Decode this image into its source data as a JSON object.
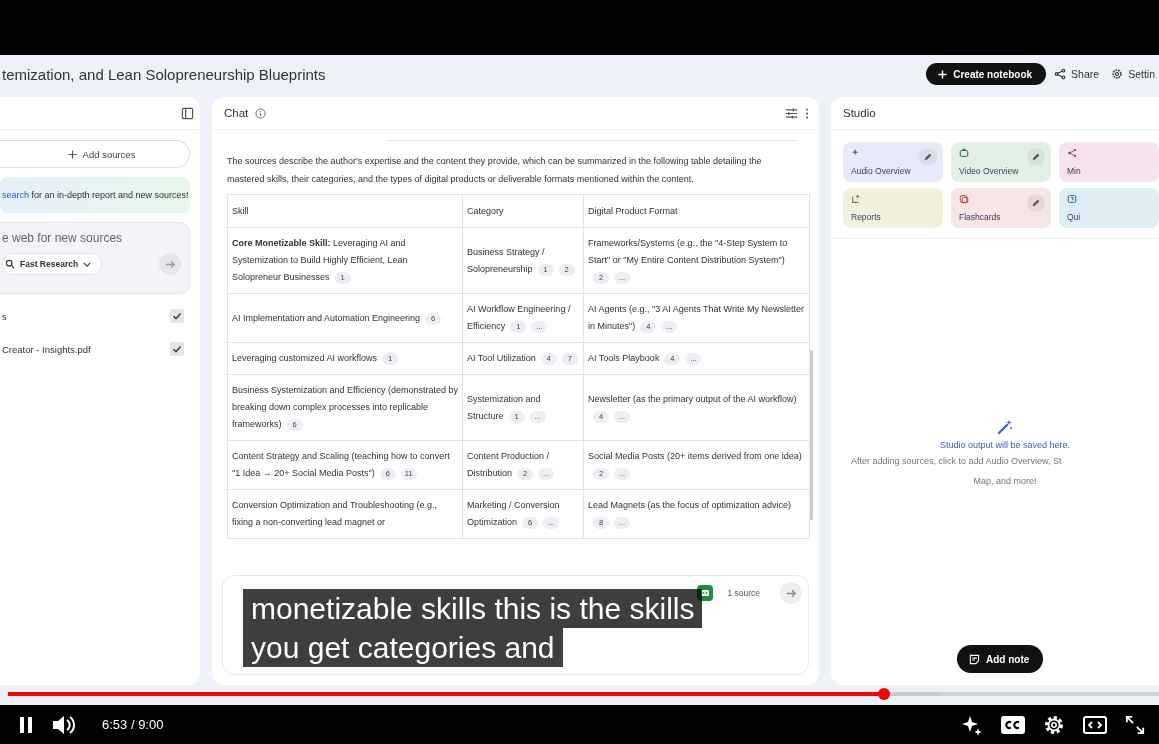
{
  "notebook_title": "temization, and Lean Solopreneurship Blueprints",
  "header_actions": {
    "create": "Create notebook",
    "share": "Share",
    "settings": "Settin"
  },
  "sources_panel": {
    "add_sources": "Add sources",
    "tip_link": "search",
    "tip_text": " for an in-depth report and new sources!",
    "search_placeholder": "e web for new sources",
    "mode": "Fast Research",
    "sources": [
      {
        "name": "s",
        "checked": true
      },
      {
        "name": "Creator - Insights.pdf",
        "checked": true
      }
    ]
  },
  "chat": {
    "title": "Chat",
    "intro": "The sources describe the author's expertise and the content they provide, which can be summarized in the following table detailing the mastered skills, their categories, and the types of digital products or deliverable formats mentioned within the content.",
    "table": {
      "columns": [
        "Skill",
        "Category",
        "Digital Product Format"
      ],
      "rows": [
        {
          "cells": [
            {
              "text": "**Core Monetizable Skill:** Leveraging AI and Systemization to Build Highly Efficient, Lean Solopreneur Businesses",
              "cites": [
                "1"
              ]
            },
            {
              "text": "Business Strategy / Solopreneurship",
              "cites": [
                "1",
                "2"
              ]
            },
            {
              "text": "Frameworks/Systems (e.g., the \"4-Step System to Start\" or \"My Entire Content Distribution System\")",
              "cites": [
                "2",
                "..."
              ]
            }
          ]
        },
        {
          "cells": [
            {
              "text": "AI Implementation and Automation Engineering",
              "cites": [
                "6"
              ]
            },
            {
              "text": "AI Workflow Engineering / Efficiency",
              "cites": [
                "1",
                "..."
              ]
            },
            {
              "text": "AI Agents (e.g., \"3 AI Agents That Write My Newsletter in Minutes\")",
              "cites": [
                "4",
                "..."
              ]
            }
          ]
        },
        {
          "cells": [
            {
              "text": "Leveraging customized AI workflows",
              "cites": [
                "1"
              ]
            },
            {
              "text": "AI Tool Utilization",
              "cites": [
                "4",
                "7"
              ]
            },
            {
              "text": "AI Tools Playbook",
              "cites": [
                "4",
                "..."
              ]
            }
          ]
        },
        {
          "cells": [
            {
              "text": "Business Systemization and Efficiency (demonstrated by breaking down complex processes into replicable frameworks)",
              "cites": [
                "6"
              ]
            },
            {
              "text": "Systemization and Structure",
              "cites": [
                "1",
                "..."
              ]
            },
            {
              "text": "Newsletter (as the primary output of the AI workflow)",
              "cites": [
                "4",
                "..."
              ]
            }
          ]
        },
        {
          "cells": [
            {
              "text": "Content Strategy and Scaling (teaching how to convert \"1 Idea → 20+ Social Media Posts\")",
              "cites": [
                "6",
                "11"
              ]
            },
            {
              "text": "Content Production / Distribution",
              "cites": [
                "2",
                "..."
              ]
            },
            {
              "text": "Social Media Posts (20+ items derived from one idea)",
              "cites": [
                "2",
                "..."
              ]
            }
          ]
        },
        {
          "cells": [
            {
              "text": "Conversion Optimization and Troubleshooting (e.g., fixing a non-converting lead magnet or"
            },
            {
              "text": "Marketing / Conversion Optimization",
              "cites": [
                "6",
                "..."
              ]
            },
            {
              "text": "Lead Magnets (as the focus of optimization advice)",
              "cites": [
                "8",
                "..."
              ]
            }
          ]
        }
      ]
    },
    "source_count": "1 source"
  },
  "studio": {
    "title": "Studio",
    "tiles": [
      {
        "kind": "audio",
        "label": "Audio Overview",
        "editable": true,
        "color": "#e8eaf8"
      },
      {
        "kind": "video",
        "label": "Video Overview",
        "editable": true,
        "color": "#e2f1e5"
      },
      {
        "kind": "mindmap",
        "label": "Min",
        "editable": false,
        "color": "#f6e3ee"
      },
      {
        "kind": "reports",
        "label": "Reports",
        "editable": false,
        "color": "#f1f1de"
      },
      {
        "kind": "flashcards",
        "label": "Flashcards",
        "editable": true,
        "color": "#f8e5e5"
      },
      {
        "kind": "quiz",
        "label": "Qui",
        "editable": false,
        "color": "#ddeff4"
      }
    ],
    "empty_title": "Studio output will be saved here.",
    "empty_text_1": "After adding sources, click to add Audio Overview, St",
    "empty_text_2": "Map, and more!",
    "add_note": "Add note"
  },
  "captions": [
    "monetizable skills this is the skills",
    "you get categories and"
  ],
  "player": {
    "level": 0.761,
    "time": "6:53 / 9:00",
    "playing": true
  }
}
